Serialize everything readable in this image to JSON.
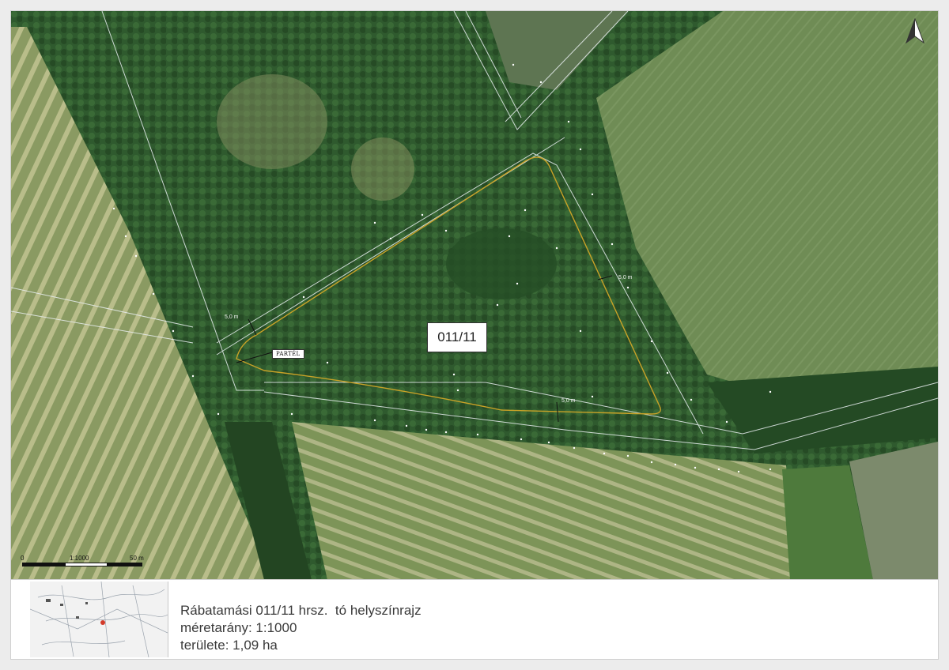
{
  "map": {
    "parcel_label": "011/11",
    "partel_label": "PARTÉL",
    "buffer_widths": [
      "5,0 m",
      "5,0 m",
      "5,0 m"
    ],
    "north_arrow_icon": "north-arrow-icon",
    "scale_bar": {
      "start": "0",
      "ratio": "1:1000",
      "end": "50 m"
    },
    "colors": {
      "parcel_boundary": "#c9a227",
      "cadastral_lines": "#e8eef0",
      "forest": "#2f5a2e",
      "field": "#6f8c55"
    }
  },
  "legend": {
    "title": "Rábatamási 011/11 hrsz.  tó helyszínrajz",
    "scale_line": "méretarány: 1:1000",
    "area_line": "területe: 1,09 ha",
    "inset_marker_color": "#d33a2a"
  }
}
